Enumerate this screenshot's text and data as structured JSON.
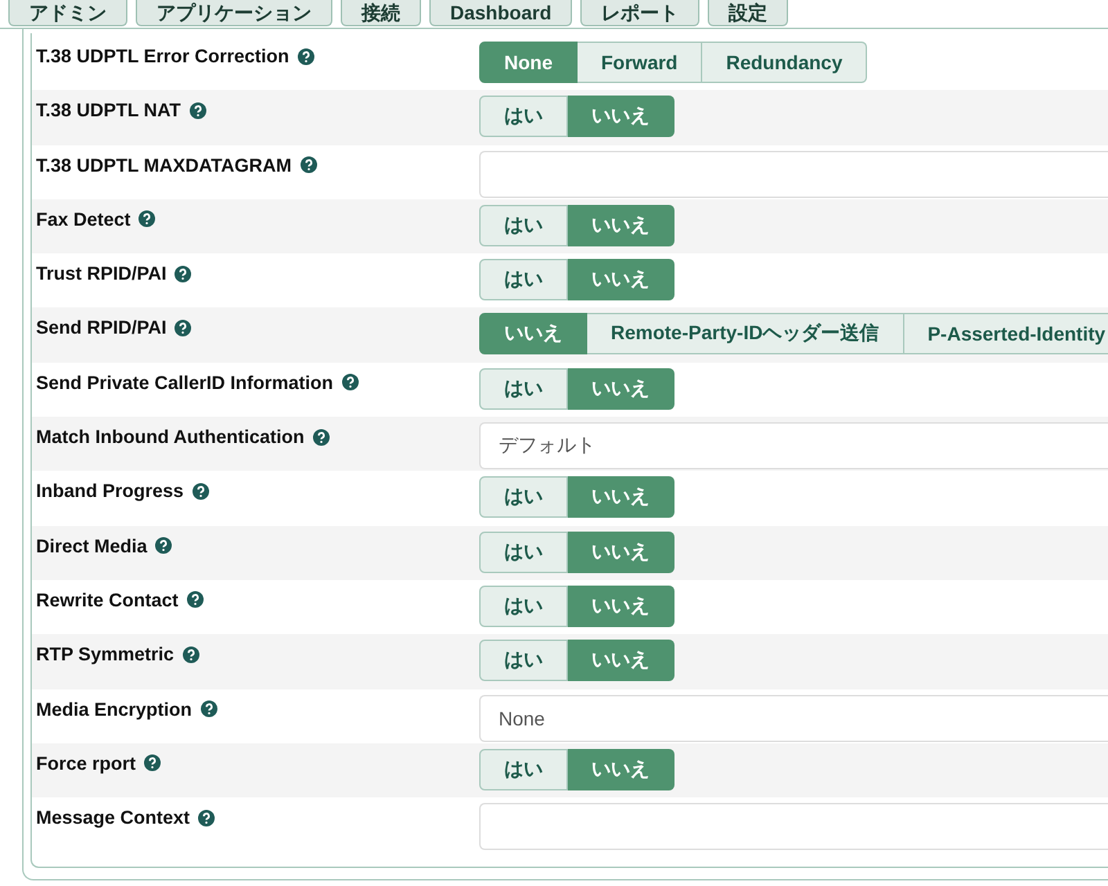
{
  "tabs": [
    {
      "label": "アドミン"
    },
    {
      "label": "アプリケーション"
    },
    {
      "label": "接続"
    },
    {
      "label": "Dashboard"
    },
    {
      "label": "レポート"
    },
    {
      "label": "設定"
    }
  ],
  "rows": [
    {
      "label": "T.38 UDPTL Error Correction",
      "kind": "toggle",
      "options": [
        {
          "label": "None",
          "selected": true
        },
        {
          "label": "Forward",
          "selected": false
        },
        {
          "label": "Redundancy",
          "selected": false
        }
      ]
    },
    {
      "label": "T.38 UDPTL NAT",
      "kind": "toggle",
      "options": [
        {
          "label": "はい",
          "selected": false
        },
        {
          "label": "いいえ",
          "selected": true
        }
      ]
    },
    {
      "label": "T.38 UDPTL MAXDATAGRAM",
      "kind": "field"
    },
    {
      "label": "Fax Detect",
      "kind": "toggle",
      "options": [
        {
          "label": "はい",
          "selected": false
        },
        {
          "label": "いいえ",
          "selected": true
        }
      ]
    },
    {
      "label": "Trust RPID/PAI",
      "kind": "toggle",
      "options": [
        {
          "label": "はい",
          "selected": false
        },
        {
          "label": "いいえ",
          "selected": true
        }
      ]
    },
    {
      "label": "Send RPID/PAI",
      "kind": "toggle",
      "options": [
        {
          "label": "いいえ",
          "selected": true
        },
        {
          "label": "Remote-Party-IDヘッダー送信",
          "selected": false
        },
        {
          "label": "P-Asserted-Identity",
          "selected": false
        }
      ]
    },
    {
      "label": "Send Private CallerID Information",
      "kind": "toggle",
      "options": [
        {
          "label": "はい",
          "selected": false
        },
        {
          "label": "いいえ",
          "selected": true
        }
      ]
    },
    {
      "label": "Match Inbound Authentication",
      "kind": "select",
      "value": "デフォルト"
    },
    {
      "label": "Inband Progress",
      "kind": "toggle",
      "options": [
        {
          "label": "はい",
          "selected": false
        },
        {
          "label": "いいえ",
          "selected": true
        }
      ]
    },
    {
      "label": "Direct Media",
      "kind": "toggle",
      "options": [
        {
          "label": "はい",
          "selected": false
        },
        {
          "label": "いいえ",
          "selected": true
        }
      ]
    },
    {
      "label": "Rewrite Contact",
      "kind": "toggle",
      "options": [
        {
          "label": "はい",
          "selected": false
        },
        {
          "label": "いいえ",
          "selected": true
        }
      ]
    },
    {
      "label": "RTP Symmetric",
      "kind": "toggle",
      "options": [
        {
          "label": "はい",
          "selected": false
        },
        {
          "label": "いいえ",
          "selected": true
        }
      ]
    },
    {
      "label": "Media Encryption",
      "kind": "select",
      "value": "None"
    },
    {
      "label": "Force rport",
      "kind": "toggle",
      "options": [
        {
          "label": "はい",
          "selected": false
        },
        {
          "label": "いいえ",
          "selected": true
        }
      ]
    },
    {
      "label": "Message Context",
      "kind": "field"
    }
  ]
}
